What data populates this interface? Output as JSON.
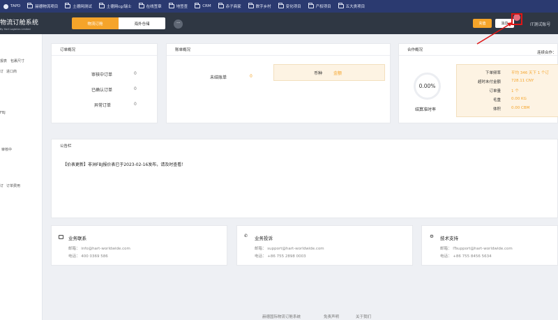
{
  "bookmarks": [
    {
      "label": "TAPD",
      "icon": "tapd-logo-icon"
    },
    {
      "label": "赫德物流项目",
      "icon": "folder-icon"
    },
    {
      "label": "土德网测试",
      "icon": "folder-icon"
    },
    {
      "label": "土德网cg/瑞士",
      "icon": "folder-icon"
    },
    {
      "label": "在线签章",
      "icon": "folder-icon"
    },
    {
      "label": "地签查",
      "icon": "folder-icon"
    },
    {
      "label": "CRM",
      "icon": "folder-icon"
    },
    {
      "label": "赤子商家",
      "icon": "folder-icon"
    },
    {
      "label": "数字乡村",
      "icon": "folder-icon"
    },
    {
      "label": "变化项目",
      "icon": "folder-icon"
    },
    {
      "label": "产权项目",
      "icon": "folder-icon"
    },
    {
      "label": "五大类项目",
      "icon": "folder-icon"
    }
  ],
  "header": {
    "brand_title": "物流订舱系统",
    "brand_sub": "By Hart Logistics Limited",
    "tab_active": "物流订舱",
    "tab_inactive": "海外仓储",
    "more_icon": "···",
    "btn_orange": "充值",
    "btn_white": "消息",
    "user": "IT测试账号"
  },
  "sidebar": [
    {
      "label": "报表"
    },
    {
      "label": "包裹尺寸"
    },
    {
      "label": "订"
    },
    {
      "label": "进口商"
    },
    {
      "label": "FBJ"
    },
    {
      "label": "审核中"
    },
    {
      "label": "订"
    },
    {
      "label": "订单费用"
    }
  ],
  "order_overview": {
    "title": "订单概况",
    "rows": [
      {
        "label": "审核中订单",
        "value": "0"
      },
      {
        "label": "已确认订单",
        "value": "0"
      },
      {
        "label": "异常订单",
        "value": "0"
      }
    ]
  },
  "account_overview": {
    "title": "账单概况",
    "unsettled_label": "未结账单",
    "unsettled_value": "0",
    "currency_label": "币种",
    "amount_label": "金额"
  },
  "cooperation": {
    "title": "合作概况",
    "right_label": "连续合作：",
    "rate_value": "0.00%",
    "rate_label": "结算准时率",
    "rows": [
      {
        "label": "下单频率",
        "value": "平均 346 天下 1 个订"
      },
      {
        "label": "超时未付金额",
        "value": "728.11 CNY"
      },
      {
        "label": "订单量",
        "value": "1 个"
      },
      {
        "label": "毛重",
        "value": "0.00 KG"
      },
      {
        "label": "体积",
        "value": "0.00 CBM"
      }
    ]
  },
  "notice": {
    "title": "公告栏",
    "text": "【价表更新】非洲FBJ报价表已于2023-02-16发布，请及时查看！"
  },
  "contacts": [
    {
      "title": "业务联系",
      "icon": "mail-icon",
      "email": "邮箱：  info@hart-worldwide.com",
      "phone": "电话：  400 0369 586"
    },
    {
      "title": "业务投诉",
      "icon": "phone-icon",
      "email": "邮箱：  support@hart-worldwide.com",
      "phone": "电话：  +86 755 2898 0003"
    },
    {
      "title": "技术支持",
      "icon": "gear-icon",
      "email": "邮箱：  ITsupport@hart-worldwide.com",
      "phone": "电话：  +86 755 8456 5634"
    }
  ],
  "footer": {
    "links": [
      "赫德国际物流订舱系统",
      "免责声明",
      "关于我们"
    ]
  },
  "colors": {
    "accent": "#f5a42a",
    "header_bg": "#2f3743",
    "bookmark_bg": "#2b3a70",
    "annotation": "#e01515"
  }
}
